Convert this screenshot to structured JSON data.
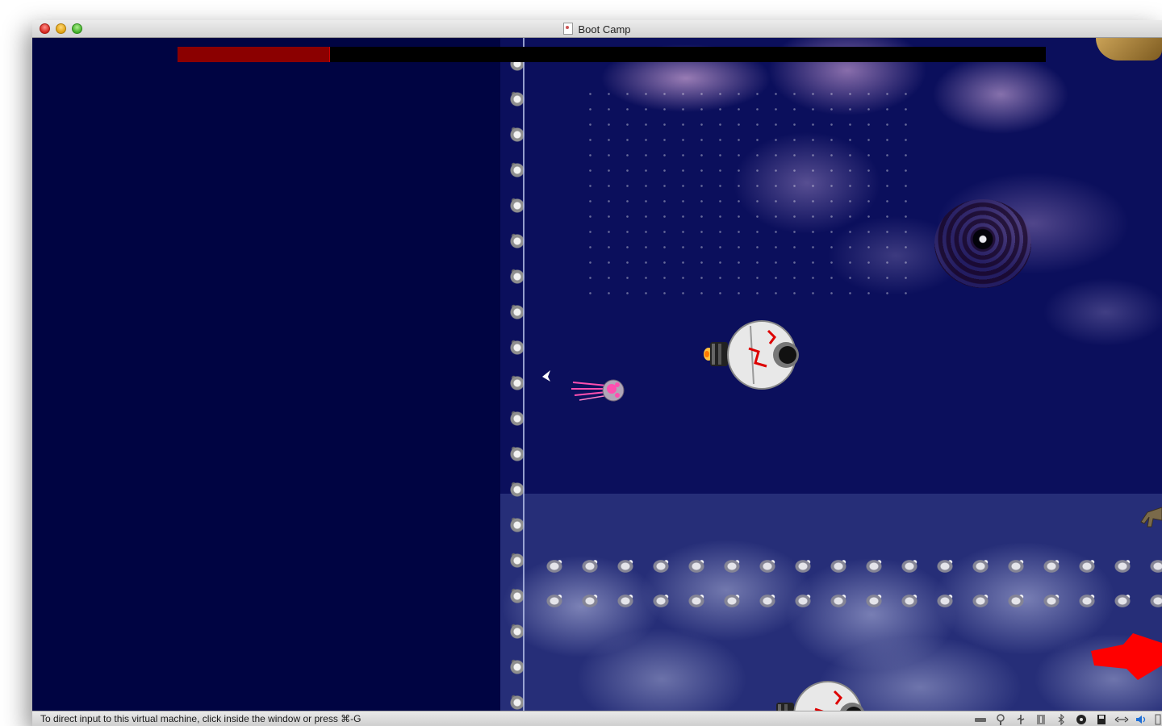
{
  "window": {
    "title": "Boot Camp"
  },
  "game": {
    "health_fraction": 0.175,
    "colors": {
      "background": "#000442",
      "health_fill": "#8b0000",
      "health_track": "#000000",
      "player": "#ff4fb0",
      "arrow": "#ff0000"
    }
  },
  "statusbar": {
    "message": "To direct input to this virtual machine, click inside the window or press ⌘-G",
    "tray_icons": [
      "hard-disk-icon",
      "network-icon",
      "usb-icon",
      "usb-device-icon",
      "bluetooth-icon",
      "optical-drive-icon",
      "floppy-icon",
      "shared-folders-icon",
      "volume-icon",
      "screen-icon"
    ]
  }
}
